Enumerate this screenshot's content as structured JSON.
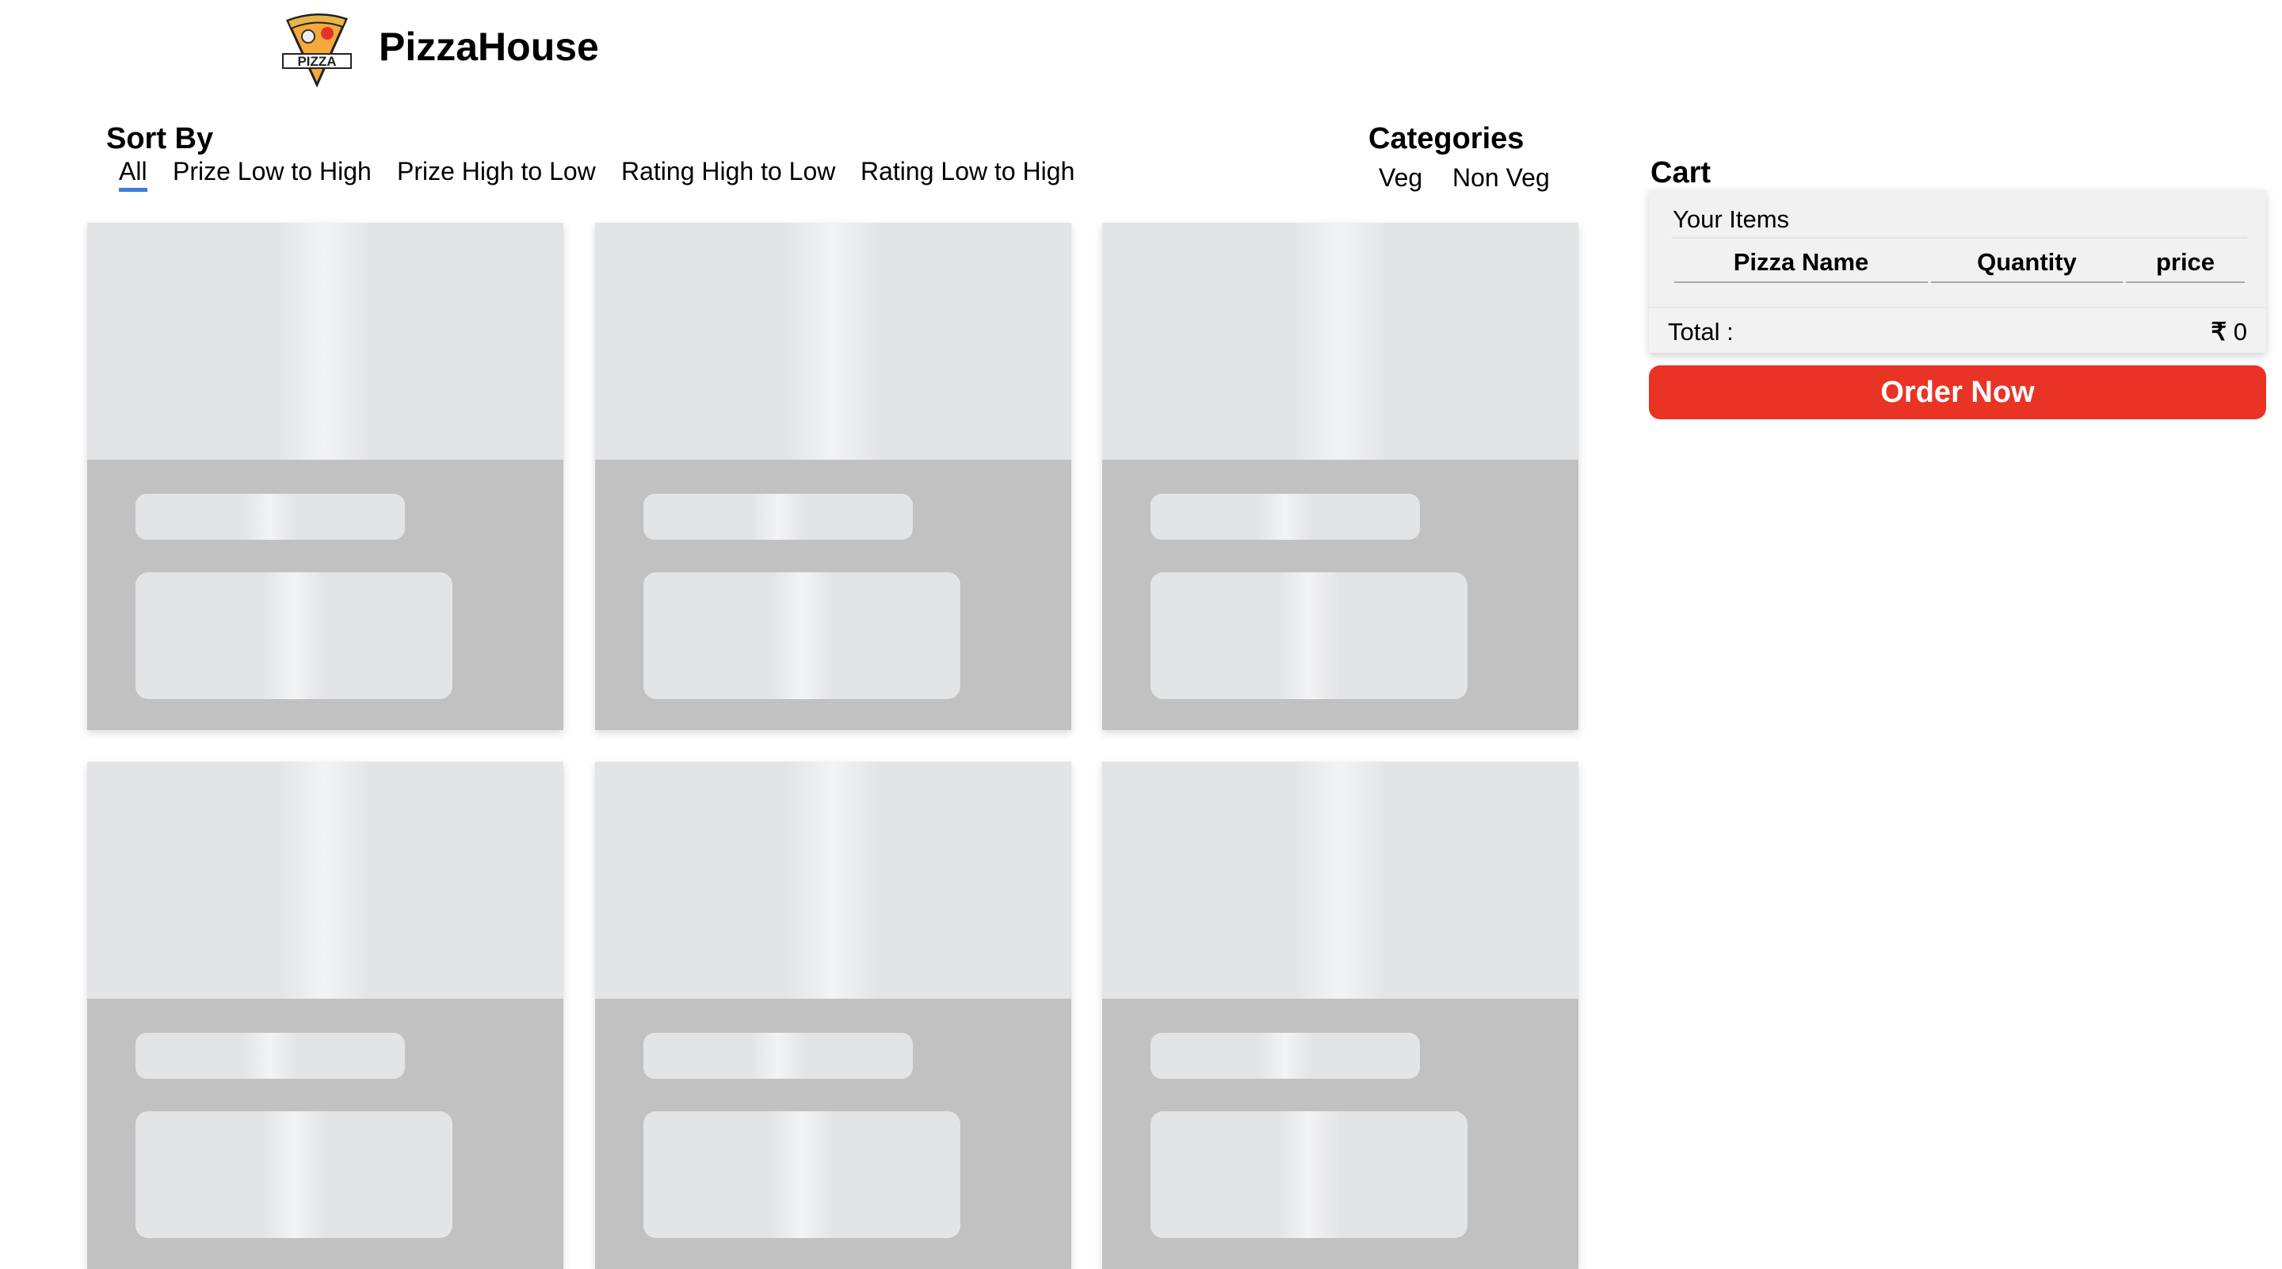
{
  "header": {
    "brand": "PizzaHouse",
    "logo_text": "PIZZA"
  },
  "sort": {
    "title": "Sort By",
    "options": [
      "All",
      "Prize Low to High",
      "Prize High to Low",
      "Rating High to Low",
      "Rating Low to High"
    ],
    "active": "All"
  },
  "categories": {
    "title": "Categories",
    "options": [
      "Veg",
      "Non Veg"
    ]
  },
  "cart": {
    "title": "Cart",
    "your_items": "Your Items",
    "columns": [
      "Pizza Name",
      "Quantity",
      "price"
    ],
    "total_label": "Total :",
    "currency": "₹",
    "total_value": "0",
    "order_button": "Order Now"
  },
  "colors": {
    "accent": "#e93325",
    "active_underline": "#3b7dd8"
  }
}
